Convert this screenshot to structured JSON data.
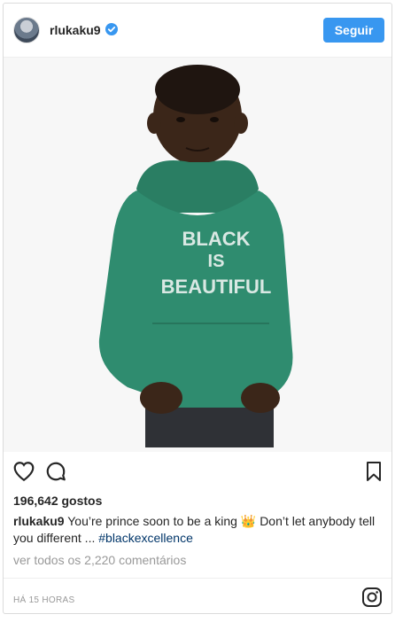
{
  "post": {
    "username": "rlukaku9",
    "follow_label": "Seguir",
    "likes": "196,642 gostos",
    "caption": {
      "user": "rlukaku9",
      "text_part1": "You’re prince soon to be a king",
      "emoji": "👑",
      "text_part2": "Don’t let anybody tell you different ...",
      "hashtag": "#blackexcellence"
    },
    "comments_link": "ver todos os 2,220 comentários",
    "timestamp": "HÁ 15 HORAS",
    "photo": {
      "hoodie_text": [
        "BLACK",
        "IS",
        "BEAUTIFUL"
      ]
    }
  },
  "icons": {
    "verified": "verified-badge-icon",
    "like": "heart-icon",
    "comment": "comment-icon",
    "save": "bookmark-icon",
    "brand": "instagram-icon"
  },
  "colors": {
    "accent": "#3897f0",
    "hashtag": "#003569",
    "hoodie": "#2f8c6f"
  }
}
